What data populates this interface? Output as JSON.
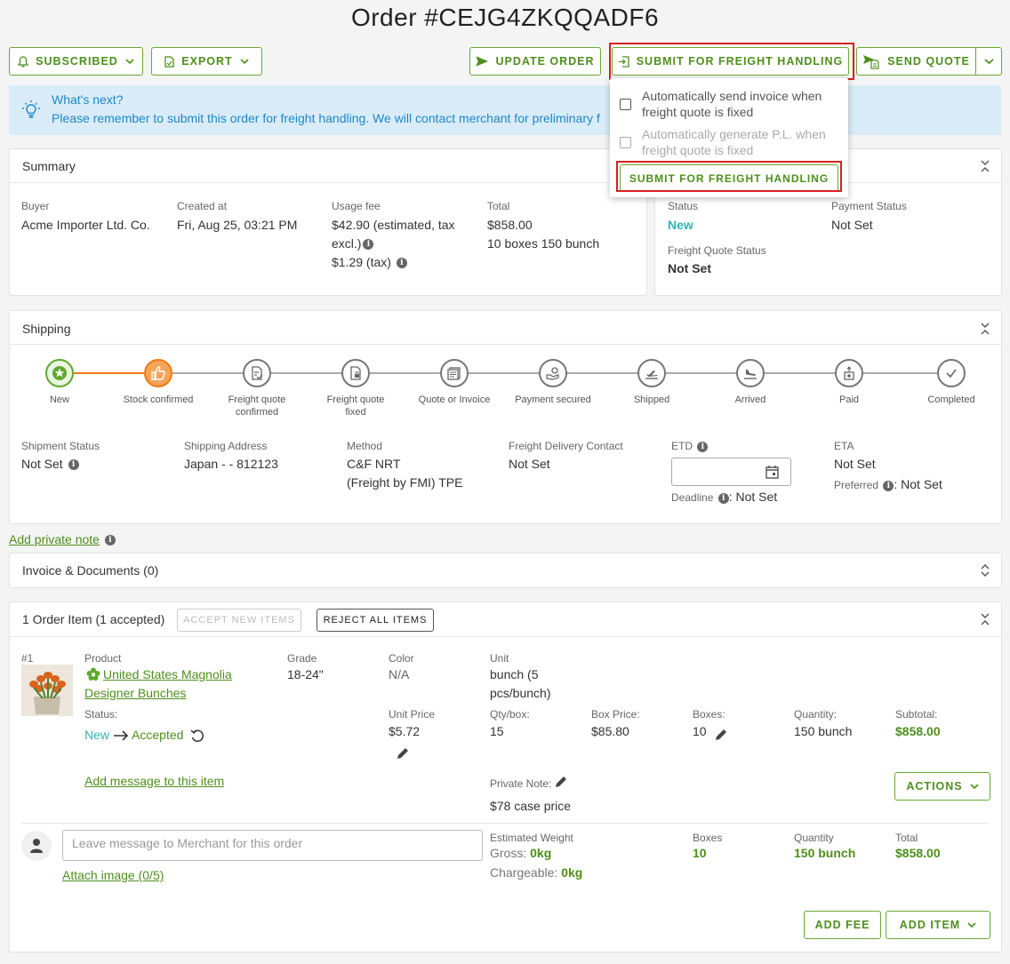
{
  "page_title": "Order #CEJG4ZKQQADF6",
  "toolbar": {
    "subscribed": "SUBSCRIBED",
    "export": "EXPORT",
    "update_order": "UPDATE ORDER",
    "submit_freight": "SUBMIT FOR FREIGHT HANDLING",
    "send_quote": "SEND QUOTE"
  },
  "banner": {
    "heading": "What's next?",
    "text": "Please remember to submit this order for freight handling. We will contact merchant for preliminary f"
  },
  "dropdown": {
    "option1": "Automatically send invoice when freight quote is fixed",
    "option2": "Automatically generate P.L. when freight quote is fixed",
    "submit": "SUBMIT FOR FREIGHT HANDLING"
  },
  "summary": {
    "title": "Summary",
    "buyer_label": "Buyer",
    "buyer": "Acme Importer Ltd. Co.",
    "created_label": "Created at",
    "created": "Fri, Aug 25, 03:21 PM",
    "usage_label": "Usage fee",
    "usage1": "$42.90 (estimated, tax excl.)",
    "usage2": "$1.29 (tax)",
    "total_label": "Total",
    "total": "$858.00",
    "total_sub": "10 boxes 150 bunch",
    "status_label": "Status",
    "status": "New",
    "payment_label": "Payment Status",
    "payment": "Not Set",
    "freight_label": "Freight Quote Status",
    "freight": "Not Set"
  },
  "shipping": {
    "title": "Shipping",
    "steps": [
      {
        "label": "New"
      },
      {
        "label": "Stock confirmed"
      },
      {
        "label": "Freight quote confirmed"
      },
      {
        "label": "Freight quote fixed"
      },
      {
        "label": "Quote or Invoice"
      },
      {
        "label": "Payment secured"
      },
      {
        "label": "Shipped"
      },
      {
        "label": "Arrived"
      },
      {
        "label": "Paid"
      },
      {
        "label": "Completed"
      }
    ],
    "shipment_status_label": "Shipment Status",
    "shipment_status": "Not Set",
    "address_label": "Shipping Address",
    "address": "Japan - - 812123",
    "method_label": "Method",
    "method1": "C&F NRT",
    "method2": "(Freight by FMI) TPE",
    "contact_label": "Freight Delivery Contact",
    "contact": "Not Set",
    "etd_label": "ETD",
    "deadline_label": "Deadline",
    "deadline": ": Not Set",
    "eta_label": "ETA",
    "eta": "Not Set",
    "preferred_label": "Preferred",
    "preferred": ": Not Set"
  },
  "private_note_link": "Add private note",
  "invoice": {
    "title": "Invoice & Documents (0)"
  },
  "items": {
    "title": "1 Order Item (1 accepted)",
    "accept_new": "ACCEPT NEW ITEMS",
    "reject_all": "REJECT ALL ITEMS",
    "index": "#1",
    "product_label": "Product",
    "product": "United States Magnolia Designer Bunches",
    "grade_label": "Grade",
    "grade": "18-24\"",
    "color_label": "Color",
    "color": "N/A",
    "unit_label": "Unit",
    "unit": "bunch (5 pcs/bunch)",
    "status_label": "Status:",
    "status_from": "New",
    "status_to": "Accepted",
    "unit_price_label": "Unit Price",
    "unit_price": "$5.72",
    "qty_box_label": "Qty/box:",
    "qty_box": "15",
    "box_price_label": "Box Price:",
    "box_price": "$85.80",
    "boxes_label": "Boxes:",
    "boxes": "10",
    "quantity_label": "Quantity:",
    "quantity": "150 bunch",
    "subtotal_label": "Subtotal:",
    "subtotal": "$858.00",
    "add_message": "Add message to this item",
    "private_note_label": "Private Note:",
    "private_note": "$78 case price",
    "actions": "ACTIONS",
    "message_placeholder": "Leave message to Merchant for this order",
    "attach": "Attach image (0/5)",
    "est_weight_label": "Estimated Weight",
    "gross_label": "Gross: ",
    "gross": "0kg",
    "chargeable_label": "Chargeable: ",
    "chargeable": "0kg",
    "tot_boxes_label": "Boxes",
    "tot_boxes": "10",
    "tot_qty_label": "Quantity",
    "tot_qty": "150 bunch",
    "tot_label": "Total",
    "tot": "$858.00",
    "add_fee": "ADD FEE",
    "add_item": "ADD ITEM"
  }
}
